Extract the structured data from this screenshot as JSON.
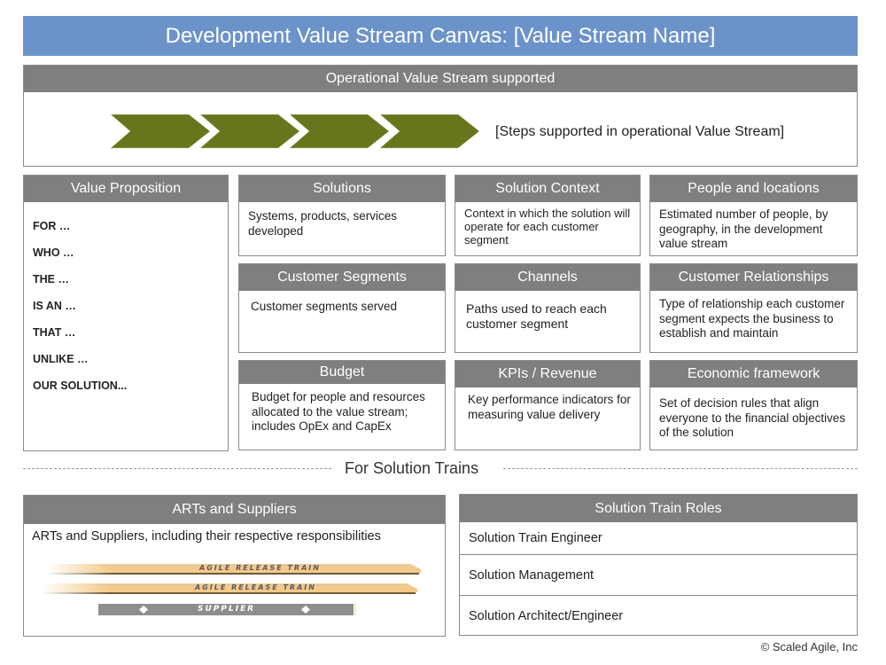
{
  "title": "Development Value Stream Canvas: [Value Stream Name]",
  "operational": {
    "header": "Operational Value Stream supported",
    "steps_text": "[Steps supported in operational Value Stream]",
    "chevron_count": 4,
    "chevron_color": "#66761d"
  },
  "value_proposition": {
    "header": "Value Proposition",
    "items": [
      "FOR …",
      "WHO …",
      "THE …",
      "IS AN …",
      "THAT …",
      "UNLIKE …",
      "OUR SOLUTION..."
    ]
  },
  "boxes": {
    "solutions": {
      "header": "Solutions",
      "body": "Systems, products, services developed"
    },
    "solution_context": {
      "header": "Solution Context",
      "body": "Context in which the solution will operate for each customer segment"
    },
    "people_locations": {
      "header": "People and locations",
      "body": "Estimated number of people, by geography, in the development value stream"
    },
    "customer_segments": {
      "header": "Customer Segments",
      "body": "Customer segments served"
    },
    "channels": {
      "header": "Channels",
      "body": "Paths used to reach each customer segment"
    },
    "customer_relationships": {
      "header": "Customer Relationships",
      "body": "Type of relationship each customer segment expects the business to establish and maintain"
    },
    "budget": {
      "header": "Budget",
      "body": "Budget for people and resources allocated to the value stream; includes OpEx and CapEx"
    },
    "kpis": {
      "header": "KPIs / Revenue",
      "body": "Key performance indicators for measuring value delivery"
    },
    "economic_framework": {
      "header": "Economic framework",
      "body": "Set of decision rules that align everyone to the financial objectives of the solution"
    }
  },
  "solution_trains_label": "For Solution Trains",
  "arts": {
    "header": "ARTs and Suppliers",
    "body": "ARTs and Suppliers, including their respective responsibilities",
    "trains": [
      "AGILE RELEASE TRAIN",
      "AGILE RELEASE TRAIN"
    ],
    "supplier": "SUPPLIER"
  },
  "roles": {
    "header": "Solution Train Roles",
    "items": [
      "Solution Train Engineer",
      "Solution Management",
      "Solution Architect/Engineer"
    ]
  },
  "copyright": "© Scaled Agile, Inc",
  "colors": {
    "title_bg": "#6c93c9",
    "header_bg": "#7f7f7f",
    "chevron": "#66761d",
    "train": "#f5c98a"
  }
}
